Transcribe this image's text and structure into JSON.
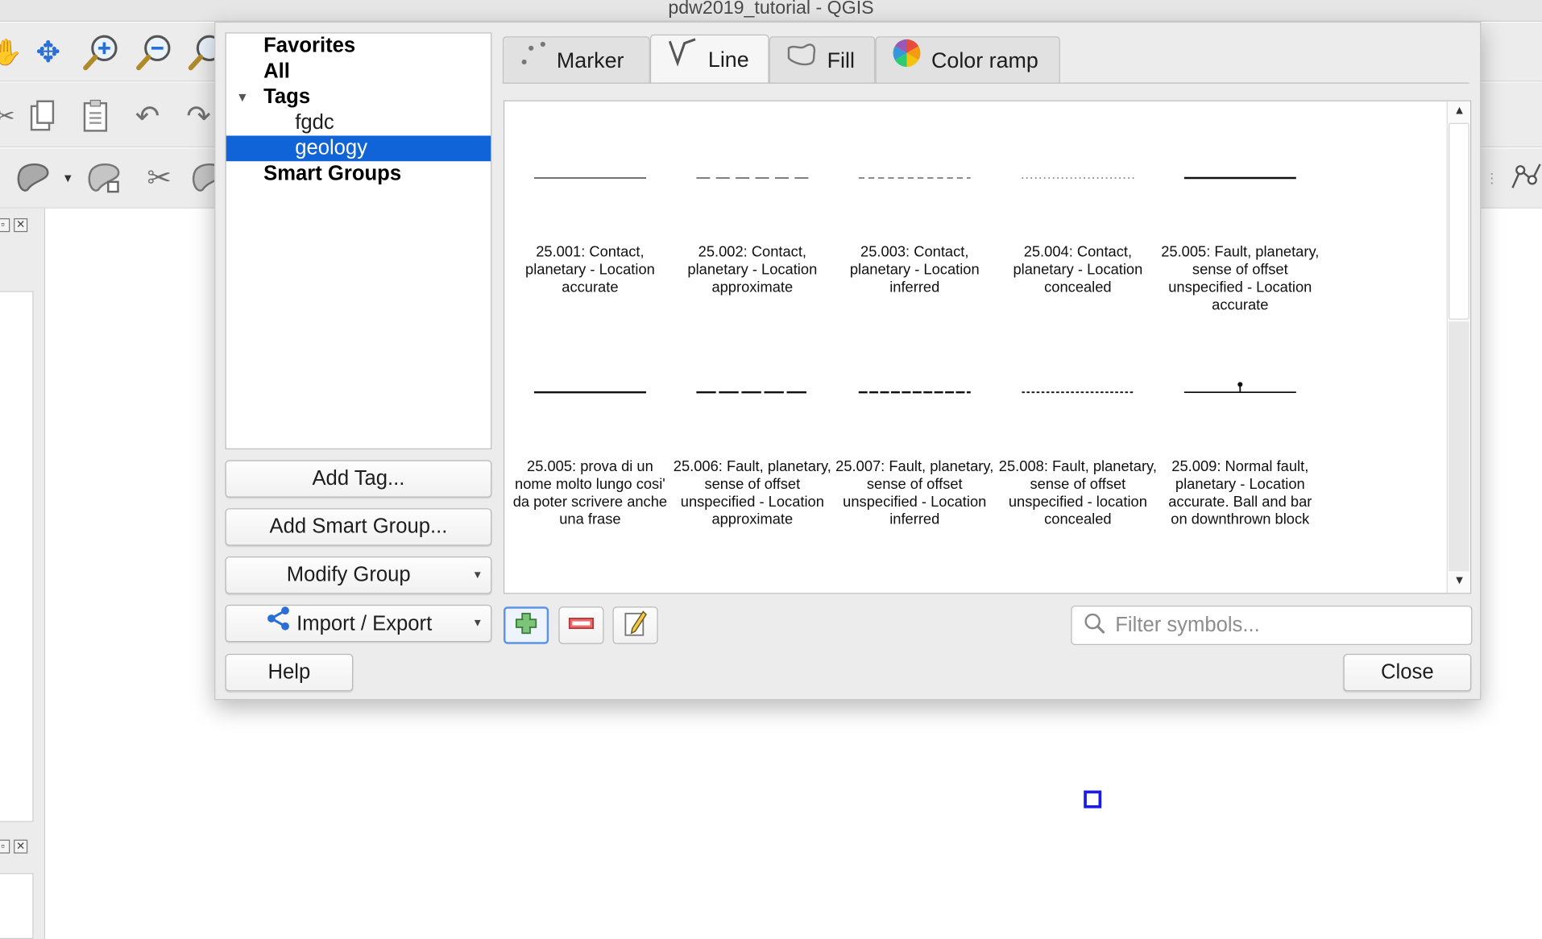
{
  "window": {
    "title": "pdw2019_tutorial - QGIS"
  },
  "dialog": {
    "tree": {
      "items": [
        {
          "label": "Favorites"
        },
        {
          "label": "All"
        },
        {
          "label": "Tags"
        },
        {
          "label": "fgdc"
        },
        {
          "label": "geology"
        },
        {
          "label": "Smart Groups"
        }
      ],
      "selected": "geology"
    },
    "buttons": {
      "add_tag": "Add Tag...",
      "add_smart_group": "Add Smart Group...",
      "modify_group": "Modify Group",
      "import_export": "Import / Export",
      "help": "Help",
      "close": "Close"
    },
    "tabs": [
      {
        "label": "Marker",
        "icon": "marker-icon"
      },
      {
        "label": "Line",
        "icon": "line-icon"
      },
      {
        "label": "Fill",
        "icon": "fill-icon"
      },
      {
        "label": "Color ramp",
        "icon": "color-ramp-icon"
      }
    ],
    "active_tab": "Line",
    "symbols": [
      {
        "name": "25.001: Contact, planetary - Location accurate",
        "style": "solid-thin"
      },
      {
        "name": "25.002: Contact, planetary - Location approximate",
        "style": "long-dash"
      },
      {
        "name": "25.003: Contact, planetary - Location inferred",
        "style": "short-dash"
      },
      {
        "name": "25.004: Contact, planetary - Location concealed",
        "style": "dotted"
      },
      {
        "name": "25.005: Fault, planetary, sense of offset unspecified - Location accurate",
        "style": "solid-thick"
      },
      {
        "name": "25.005: prova di un nome molto lungo cosi' da poter scrivere anche una frase",
        "style": "solid-thick"
      },
      {
        "name": "25.006: Fault, planetary, sense of offset unspecified - Location approximate",
        "style": "long-dash-thick"
      },
      {
        "name": "25.007: Fault, planetary, sense of offset unspecified - Location inferred",
        "style": "short-dash-thick"
      },
      {
        "name": "25.008: Fault, planetary, sense of offset unspecified - location concealed",
        "style": "dotted-thick"
      },
      {
        "name": "25.009: Normal fault, planetary - Location accurate. Ball and bar on downthrown block",
        "style": "ball-bar"
      }
    ],
    "action_icons": [
      "add-symbol-icon",
      "remove-symbol-icon",
      "edit-symbol-icon"
    ],
    "search": {
      "placeholder": "Filter symbols..."
    }
  },
  "colors": {
    "selection": "#1163d8",
    "canvas_marker": "#1a1ae6"
  }
}
